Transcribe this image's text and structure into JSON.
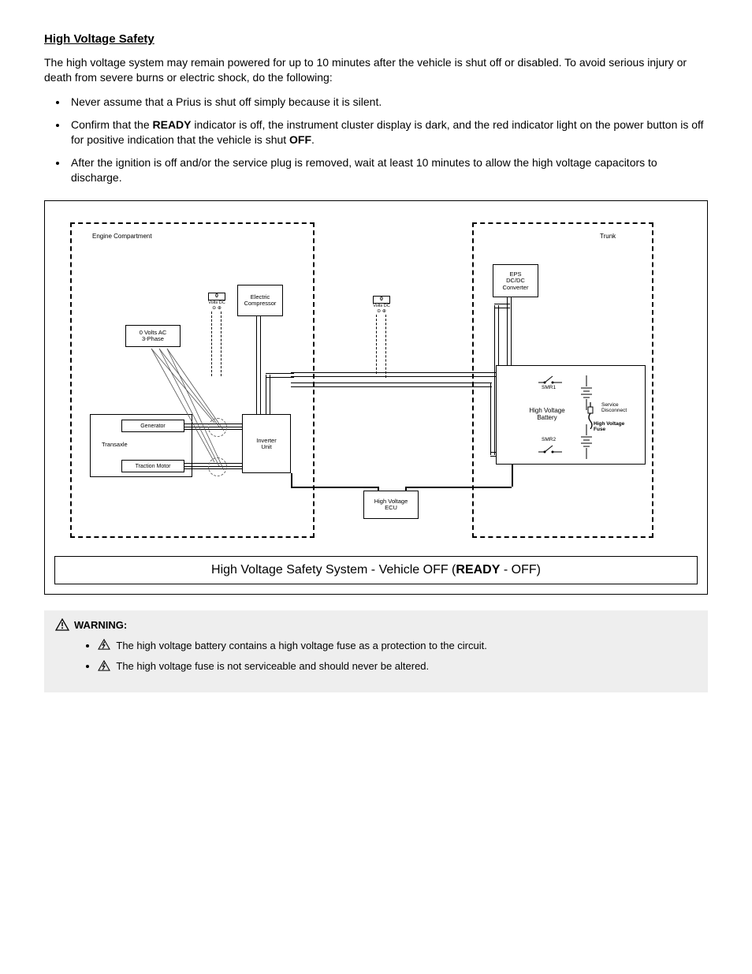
{
  "section_title": "High Voltage Safety",
  "intro": "The high voltage system may remain powered for up to 10 minutes after the vehicle is shut off or disabled. To avoid serious injury or death from severe burns or electric shock, do the following:",
  "bullets": [
    {
      "text": "Never assume that a Prius is shut off simply because it is silent."
    },
    {
      "text_pre": "Confirm that the ",
      "bold1": "READY",
      "text_mid": " indicator is off, the instrument cluster display is dark, and the red indicator light on the power button is off for positive indication that the vehicle is shut",
      "bold2": " OFF",
      "text_post": "."
    },
    {
      "text": "After the ignition is off and/or the service plug is removed, wait at least 10 minutes to allow the high voltage capacitors to discharge."
    }
  ],
  "diagram": {
    "engine_label": "Engine Compartment",
    "trunk_label": "Trunk",
    "generator": "Generator",
    "transaxle": "Transaxle",
    "traction_motor": "Traction Motor",
    "inverter": "Inverter\nUnit",
    "electric_compressor": "Electric\nCompressor",
    "hv_ecu": "High Voltage\nECU",
    "eps_converter": "EPS\nDC/DC\nConverter",
    "hv_battery": "High Voltage\nBattery",
    "volts_ac": "0 Volts AC\n3-Phase",
    "voltmeter_digits": "0",
    "voltmeter_label": "Volts DC",
    "voltmeter_probes": "⊝ ⊕",
    "service_disconnect": "Service\nDisconnect",
    "hv_fuse": "High Voltage\nFuse",
    "smr1": "SMR1",
    "smr2": "SMR2"
  },
  "caption": {
    "prefix": "High Voltage Safety System - Vehicle OFF (",
    "bold": "READY",
    "suffix": " - OFF)"
  },
  "warning": {
    "title": "WARNING:",
    "items": [
      "The high voltage battery contains a high voltage fuse as a protection to the circuit.",
      "The high voltage fuse is not serviceable and should never be altered."
    ]
  }
}
